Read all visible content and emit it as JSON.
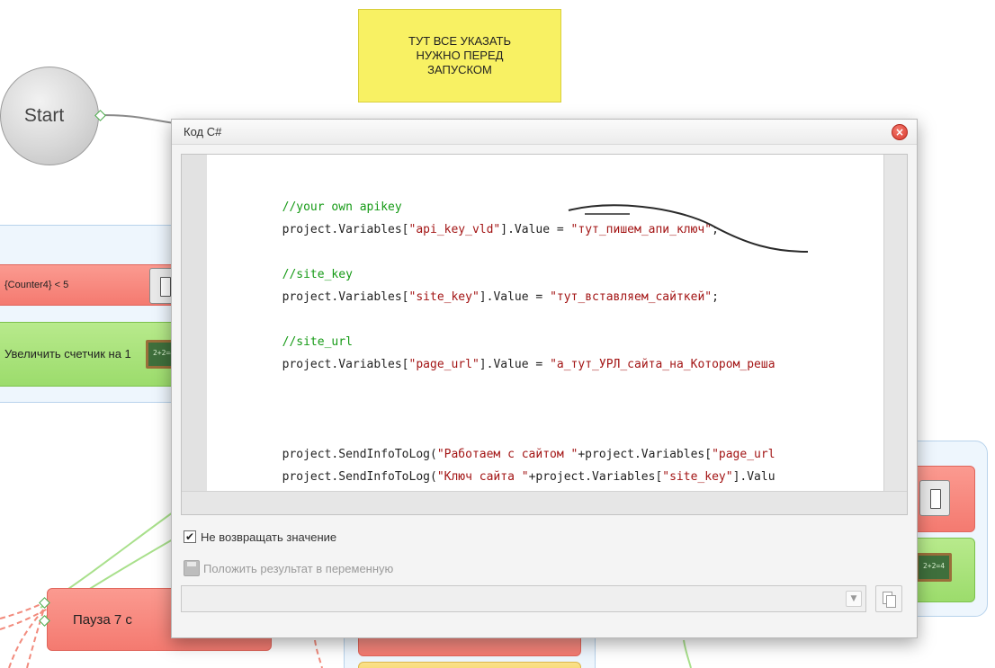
{
  "canvas": {
    "note": "ТУТ ВСЕ УКАЗАТЬ НУЖНО ПЕРЕД ЗАПУСКОМ",
    "start_label": "Start",
    "blocks": {
      "counter_condition": "{Counter4} < 5",
      "increment_counter": "Увеличить счетчик на 1",
      "pause": "Пауза 7 с"
    },
    "board_glyph": "2+2=4"
  },
  "dialog": {
    "title": "Код C#",
    "close_glyph": "×",
    "code": {
      "comment_apikey": "//your own apikey",
      "line_api_prefix": "project.Variables[",
      "line_api_key": "\"api_key_vld\"",
      "line_api_mid": "].Value = ",
      "line_api_value": "\"тут_пишем_апи_ключ\"",
      "line_api_end": ";",
      "comment_sitekey": "//site_key",
      "line_site_prefix": "project.Variables[",
      "line_site_key": "\"site_key\"",
      "line_site_mid": "].Value = ",
      "line_site_value": "\"тут_вставляем_сайткей\"",
      "line_site_end": ";",
      "comment_siteurl": "//site_url",
      "line_url_prefix": "project.Variables[",
      "line_url_key": "\"page_url\"",
      "line_url_mid": "].Value = ",
      "line_url_value": "\"а_тут_УРЛ_сайта_на_Котором_реша",
      "log1_prefix": "project.SendInfoToLog(",
      "log1_str": "\"Работаем с сайтом \"",
      "log1_mid": "+project.Variables[",
      "log1_key": "\"page_url",
      "log2_prefix": "project.SendInfoToLog(",
      "log2_str": "\"Ключ сайта \"",
      "log2_mid": "+project.Variables[",
      "log2_key": "\"site_key\"",
      "log2_end": "].Valu"
    },
    "options": {
      "no_return_label": "Не возвращать значение",
      "no_return_checked": true,
      "check_glyph": "✔",
      "store_result_label": "Положить результат в переменную",
      "store_result_enabled": false
    },
    "variable_select": {
      "value": "",
      "arrow_glyph": "▼"
    }
  },
  "colors": {
    "comment": "#159a15",
    "string": "#a31515",
    "close_button": "#d83a2e",
    "note": "#f8f163"
  }
}
